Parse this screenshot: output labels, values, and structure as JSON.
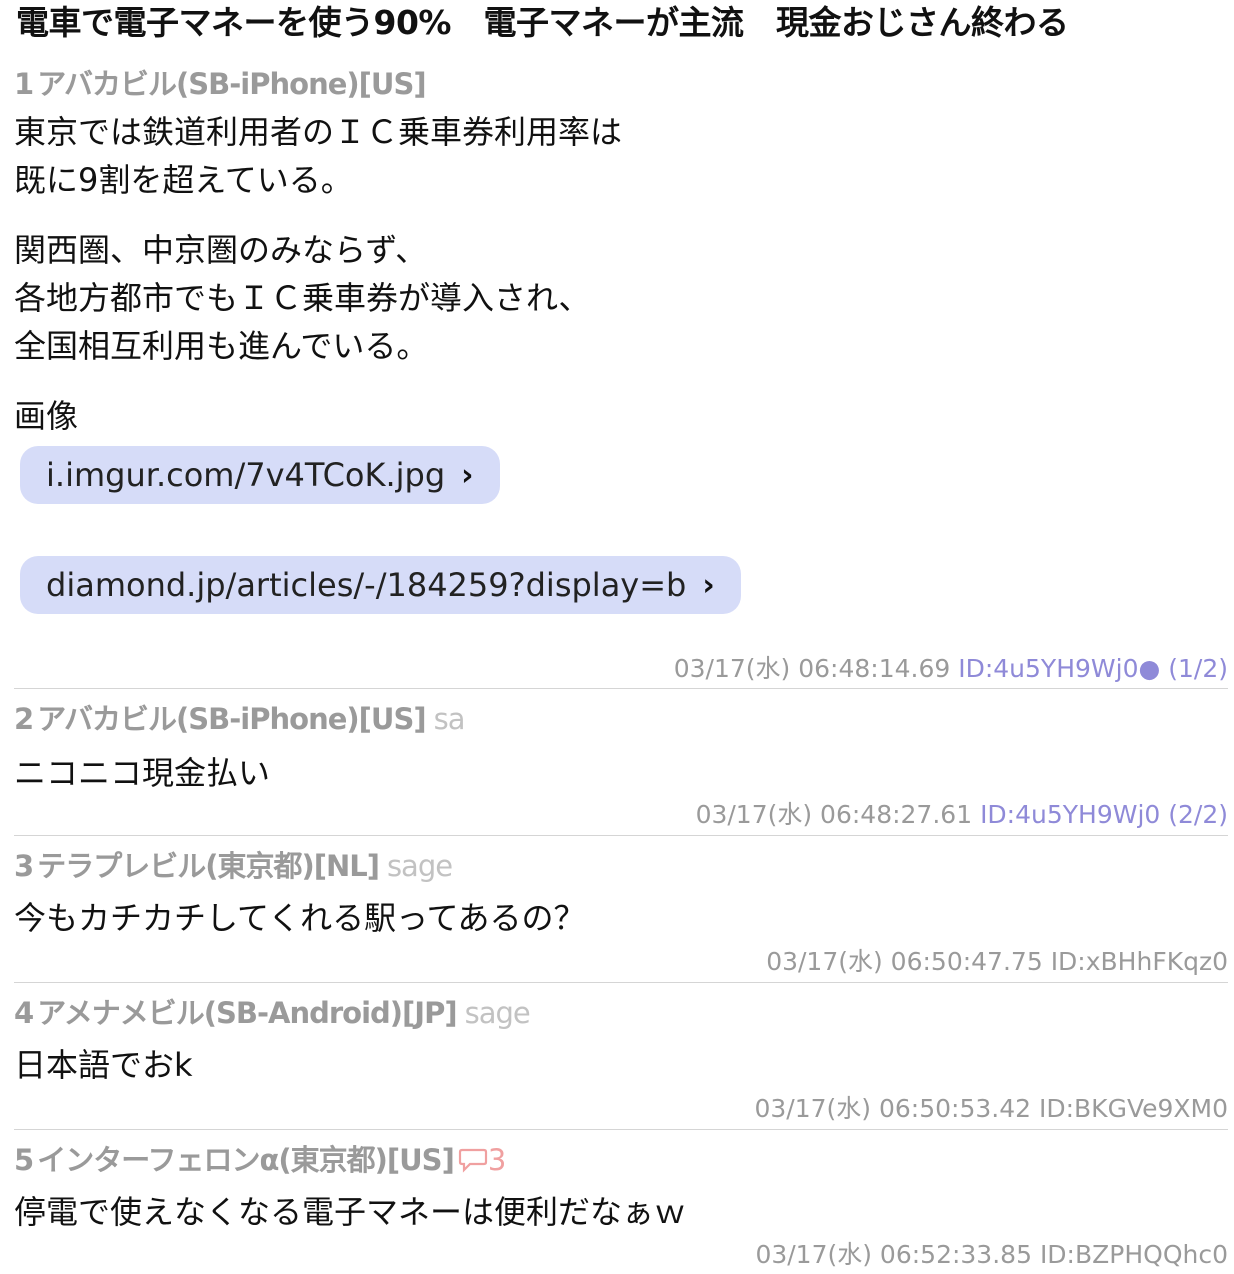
{
  "thread_title": "電車で電子マネーを使う90%　電子マネーが主流　現金おじさん終わる",
  "posts": [
    {
      "num": "1",
      "name": "アバカビル(SB-iPhone)[US]",
      "mail": "",
      "body_paragraphs": [
        "東京では鉄道利用者のＩＣ乗車券利用率は\n既に9割を超えている。",
        "関西圏、中京圏のみならず、\n各地方都市でもＩＣ乗車券が導入され、\n全国相互利用も進んでいる。",
        "画像"
      ],
      "links": [
        {
          "label": "i.imgur.com/7v4TCoK.jpg",
          "chevron": "›"
        },
        {
          "label": "diamond.jp/articles/-/184259?display=b",
          "chevron": "›"
        }
      ],
      "datetime": "03/17(水) 06:48:14.69",
      "id": "ID:4u5YH9Wj0● (1/2)"
    },
    {
      "num": "2",
      "name": "アバカビル(SB-iPhone)[US]",
      "mail": "sa",
      "body": "ニコニコ現金払い",
      "datetime": "03/17(水) 06:48:27.61",
      "id": "ID:4u5YH9Wj0 (2/2)"
    },
    {
      "num": "3",
      "name": "テラプレビル(東京都)[NL]",
      "mail": "sage",
      "body": "今もカチカチしてくれる駅ってあるの？",
      "datetime": "03/17(水) 06:50:47.75",
      "id": "ID:xBHhFKqz0"
    },
    {
      "num": "4",
      "name": "アメナメビル(SB-Android)[JP]",
      "mail": "sage",
      "body": "日本語でおk",
      "datetime": "03/17(水) 06:50:53.42",
      "id": "ID:BKGVe9XM0"
    },
    {
      "num": "5",
      "name": "インターフェロンα(東京都)[US]",
      "reply_icon": "speech-bubble-icon",
      "reply_count": "3",
      "body": "停電で使えなくなる電子マネーは便利だなぁｗ",
      "datetime": "03/17(水) 06:52:33.85",
      "id": "ID:BZPHQQhc0"
    }
  ]
}
